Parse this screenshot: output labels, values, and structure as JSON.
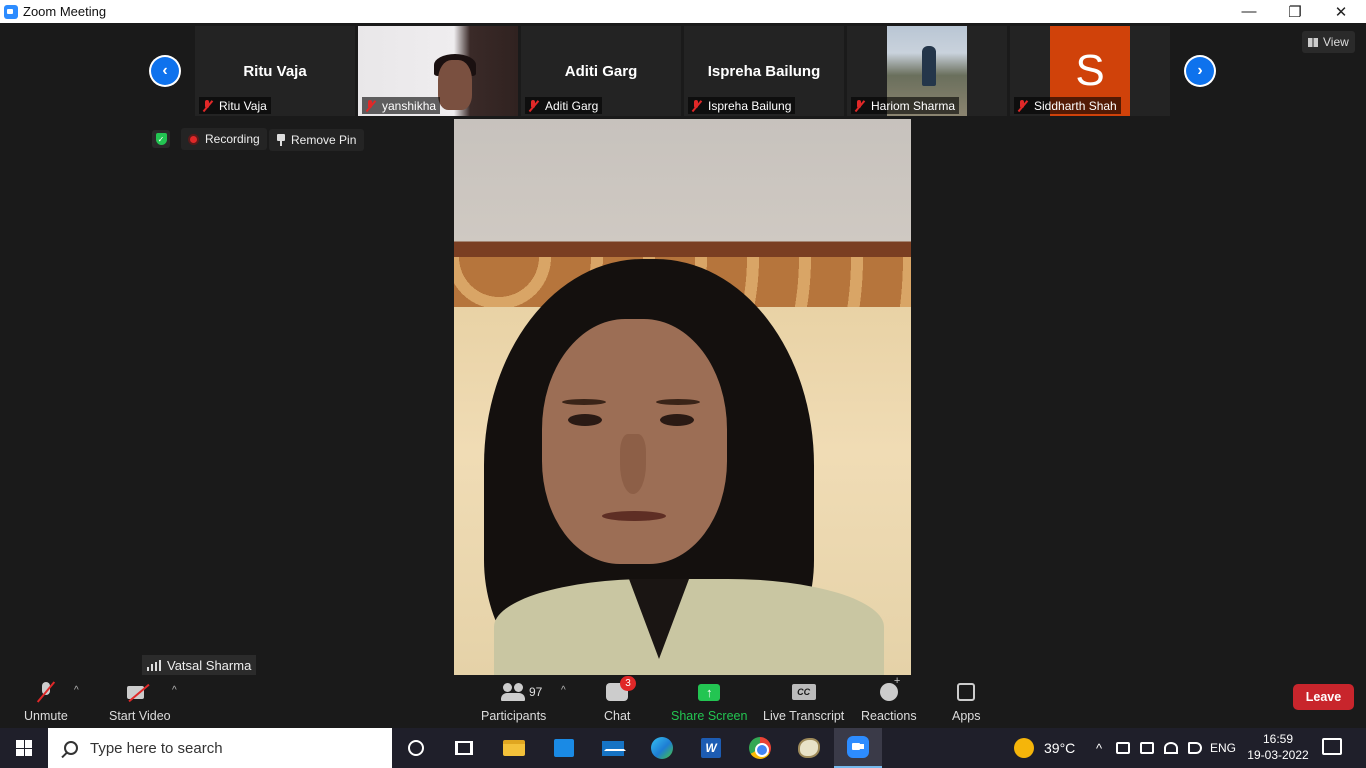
{
  "window": {
    "title": "Zoom Meeting",
    "controls": {
      "minimize": "—",
      "maximize": "❐",
      "close": "✕"
    }
  },
  "gallery": {
    "prev_arrow": "‹",
    "next_arrow": "›",
    "view_label": "View",
    "tiles": [
      {
        "display": "name",
        "big_name": "Ritu Vaja",
        "label": "Ritu Vaja",
        "muted": true
      },
      {
        "display": "video",
        "big_name": "",
        "label": "yanshikha",
        "muted": true
      },
      {
        "display": "name",
        "big_name": "Aditi Garg",
        "label": "Aditi Garg",
        "muted": true
      },
      {
        "display": "name",
        "big_name": "Ispreha Bailung",
        "label": "Ispreha Bailung",
        "muted": true
      },
      {
        "display": "photo",
        "big_name": "",
        "label": "Hariom Sharma",
        "muted": true
      },
      {
        "display": "avatar",
        "avatar_letter": "S",
        "avatar_color": "#d0420a",
        "label": "Siddharth Shah",
        "muted": true
      }
    ]
  },
  "status": {
    "recording_label": "Recording",
    "remove_pin_label": "Remove Pin",
    "shield_icon": "✓"
  },
  "main": {
    "speaker_name": "Vatsal Sharma"
  },
  "toolbar": {
    "unmute_label": "Unmute",
    "start_video_label": "Start Video",
    "participants_label": "Participants",
    "participants_count": "97",
    "chat_label": "Chat",
    "chat_badge": "3",
    "share_label": "Share Screen",
    "share_icon": "↑",
    "transcript_label": "Live Transcript",
    "transcript_icon": "CC",
    "reactions_label": "Reactions",
    "apps_label": "Apps",
    "leave_label": "Leave",
    "caret": "^"
  },
  "taskbar": {
    "search_placeholder": "Type here to search",
    "word_letter": "W",
    "weather_temp": "39°C",
    "tray_chevron": "^",
    "language": "ENG",
    "time": "16:59",
    "date": "19-03-2022"
  },
  "colors": {
    "zoom_blue": "#2d8cff",
    "leave_red": "#c8252c",
    "share_green": "#23c552",
    "mute_red": "#e02828"
  }
}
